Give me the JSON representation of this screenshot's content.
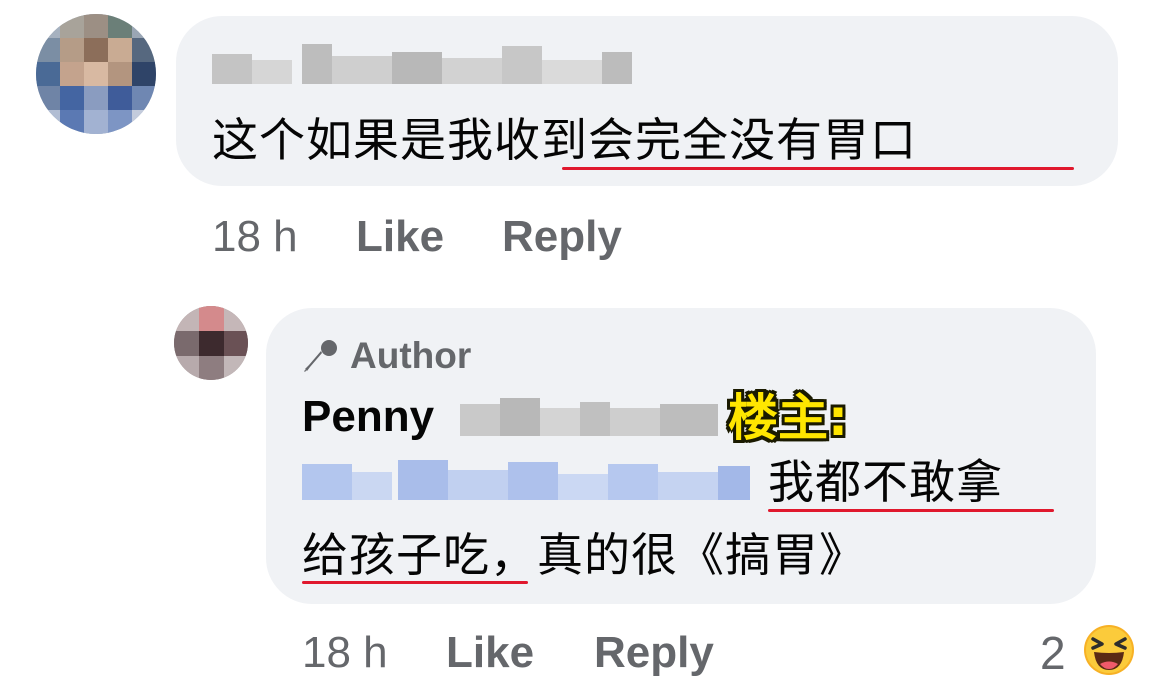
{
  "comments": [
    {
      "text_a": "这个如果是我",
      "text_b": "收到会完全没有胃口",
      "time": "18 h",
      "like_label": "Like",
      "reply_label": "Reply"
    },
    {
      "author_badge": "Author",
      "name": "Penny",
      "annotation": "楼主:",
      "line1": "我都不敢拿",
      "line2_a": "给孩子吃",
      "line2_b": "，真的很《搞胃》",
      "time": "18 h",
      "like_label": "Like",
      "reply_label": "Reply",
      "reaction_count": "2",
      "reaction_icon": "haha-emoji-icon"
    }
  ],
  "colors": {
    "bubble": "#f0f2f5",
    "meta_text": "#65676b",
    "underline": "#e0182d",
    "annotation": "#ffe600"
  }
}
